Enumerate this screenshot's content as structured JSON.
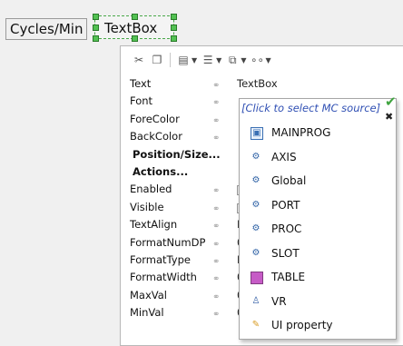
{
  "canvas": {
    "label_text": "Cycles/Min",
    "textbox_text": "TextBox"
  },
  "toolbar": {
    "icons": [
      "cut-icon",
      "copy-icon",
      "paste-icon",
      "align-icon",
      "layer-icon",
      "options-icon"
    ]
  },
  "properties": {
    "rows": [
      {
        "name": "Text",
        "value": "TextBox",
        "kind": "text"
      },
      {
        "name": "Font",
        "value": "",
        "kind": "text"
      },
      {
        "name": "ForeColor",
        "value": "",
        "kind": "text"
      },
      {
        "name": "BackColor",
        "value": "",
        "kind": "text"
      },
      {
        "name": "Position/Size...",
        "value": "",
        "kind": "header"
      },
      {
        "name": "Actions...",
        "value": "",
        "kind": "header"
      },
      {
        "name": "Enabled",
        "value": "",
        "kind": "check"
      },
      {
        "name": "Visible",
        "value": "",
        "kind": "check"
      },
      {
        "name": "TextAlign",
        "value": "L",
        "kind": "text"
      },
      {
        "name": "FormatNumDP",
        "value": "0",
        "kind": "text"
      },
      {
        "name": "FormatType",
        "value": "F",
        "kind": "text"
      },
      {
        "name": "FormatWidth",
        "value": "0",
        "kind": "text"
      },
      {
        "name": "MaxVal",
        "value": "0",
        "kind": "text"
      },
      {
        "name": "MinVal",
        "value": "0",
        "kind": "text"
      }
    ]
  },
  "mc_source_dropdown": {
    "hint": "[Click to select MC source]",
    "items": [
      {
        "label": "MAINPROG",
        "icon": "program-icon"
      },
      {
        "label": "AXIS",
        "icon": "gear-icon"
      },
      {
        "label": "Global",
        "icon": "gear-icon"
      },
      {
        "label": "PORT",
        "icon": "gear-icon"
      },
      {
        "label": "PROC",
        "icon": "gear-icon"
      },
      {
        "label": "SLOT",
        "icon": "gear-icon"
      },
      {
        "label": "TABLE",
        "icon": "table-icon"
      },
      {
        "label": "VR",
        "icon": "vr-icon"
      },
      {
        "label": "UI property",
        "icon": "ui-property-icon"
      }
    ]
  },
  "colors": {
    "accent_blue": "#2f4fb3",
    "selection_green": "#52c152",
    "confirm_green": "#3fa43f"
  }
}
